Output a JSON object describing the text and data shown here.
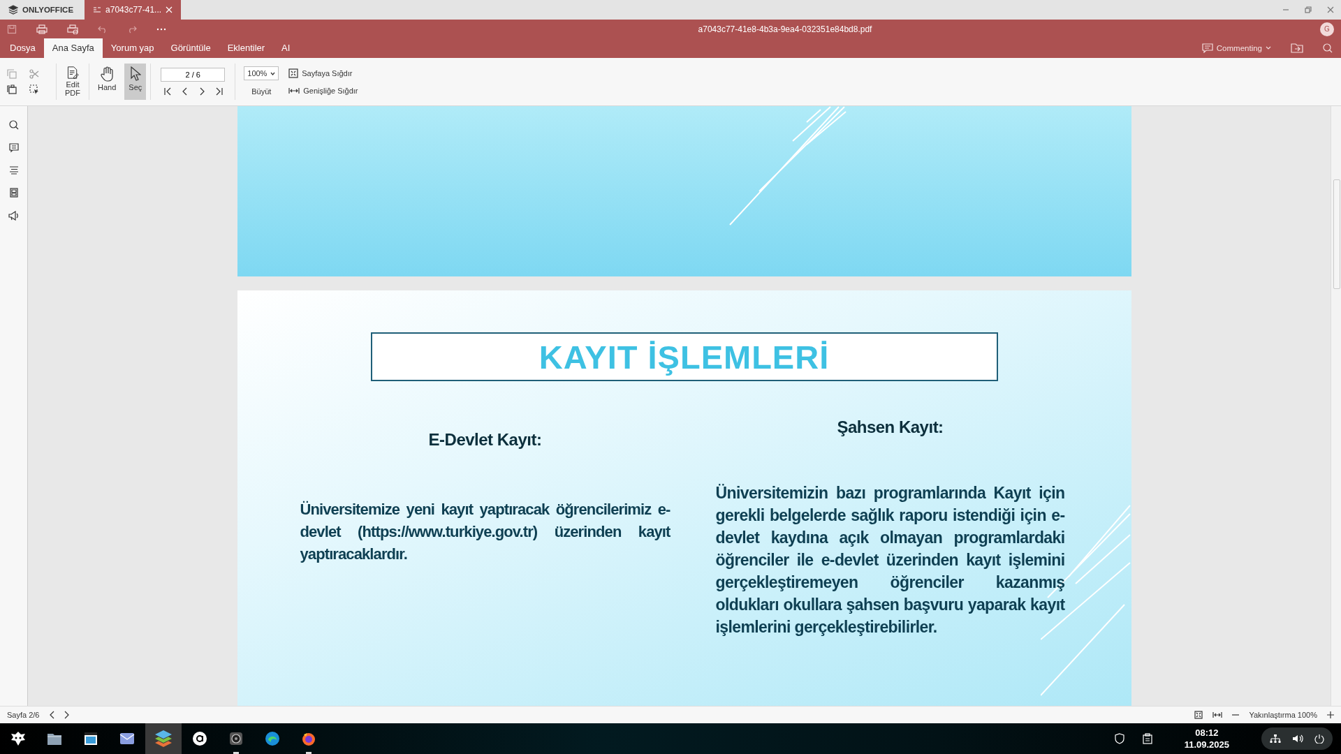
{
  "app_tabs": [
    {
      "label": "ONLYOFFICE",
      "kind": "home",
      "selected": false
    },
    {
      "label": "a7043c77-41...",
      "kind": "document",
      "selected": true
    }
  ],
  "title_bar": {
    "title": "a7043c77-41e8-4b3a-9ea4-032351e84bd8.pdf",
    "avatar": "G"
  },
  "ribbon_tabs": [
    {
      "label": "Dosya",
      "selected": false
    },
    {
      "label": "Ana Sayfa",
      "selected": true
    },
    {
      "label": "Yorum yap",
      "selected": false
    },
    {
      "label": "Görüntüle",
      "selected": false
    },
    {
      "label": "Eklentiler",
      "selected": false
    },
    {
      "label": "AI",
      "selected": false
    }
  ],
  "mode": {
    "label": "Commenting"
  },
  "toolbar": {
    "edit_pdf": "Edit\nPDF",
    "tools": [
      {
        "label": "Hand",
        "kind": "hand",
        "selected": false
      },
      {
        "label": "Seç",
        "kind": "select",
        "selected": true
      }
    ],
    "page_field": "2 / 6",
    "zoom": "100%",
    "zoom_in": "Büyüt",
    "fit_page": "Sayfaya Sığdır",
    "fit_width": "Genişliğe Sığdır"
  },
  "document": {
    "title": "KAYIT İŞLEMLERİ",
    "columns": [
      {
        "heading": "E-Devlet Kayıt:",
        "text": "Üniversitemize yeni kayıt yaptıracak öğrencilerimiz e-devlet (https://www.turkiye.gov.tr) üzerinden kayıt yaptıracaklardır."
      },
      {
        "heading": "Şahsen Kayıt:",
        "text": "Üniversitemizin bazı programlarında Kayıt için gerekli belgelerde sağlık raporu istendiği için e-devlet kaydına açık olmayan programlardaki öğrenciler ile e-devlet üzerinden kayıt işlemini gerçekleştiremeyen öğrenciler kazanmış oldukları okullara şahsen başvuru yaparak kayıt işlemlerini gerçekleştirebilirler."
      }
    ]
  },
  "status_bar": {
    "page": "Sayfa 2/6",
    "zoom": "Yakınlaştırma 100%"
  },
  "taskbar": {
    "apps": [
      {
        "kind": "files",
        "selected": false,
        "running": false
      },
      {
        "kind": "archive",
        "selected": false,
        "running": false
      },
      {
        "kind": "mail",
        "selected": false,
        "running": false
      },
      {
        "kind": "office",
        "selected": true,
        "running": false
      },
      {
        "kind": "circle-a",
        "selected": false,
        "running": false
      },
      {
        "kind": "speaker",
        "selected": false,
        "running": true
      },
      {
        "kind": "edge",
        "selected": false,
        "running": false
      },
      {
        "kind": "firefox",
        "selected": false,
        "running": true
      }
    ],
    "time": "08:12",
    "date": "11.09.2025"
  }
}
